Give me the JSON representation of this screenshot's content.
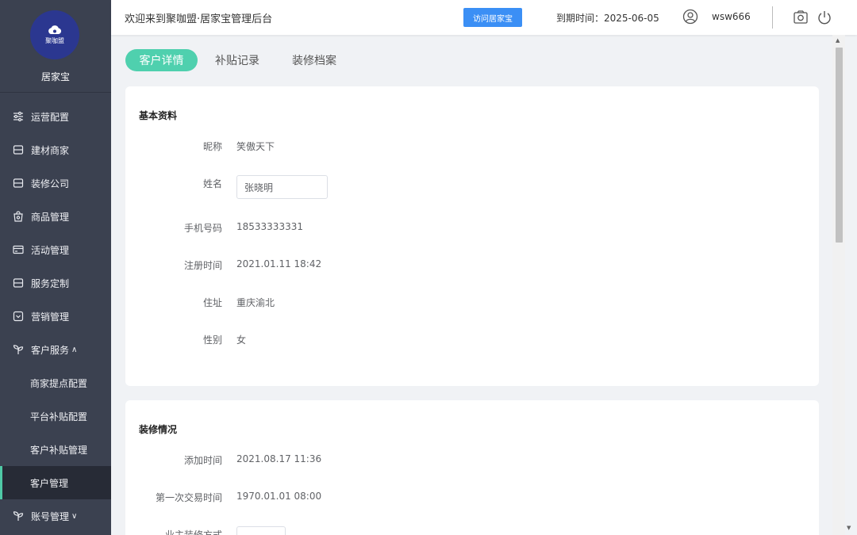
{
  "sidebar": {
    "logo_text": "聚咖盟",
    "brand": "居家宝",
    "items": [
      {
        "label": "运营配置",
        "icon": "sliders-icon"
      },
      {
        "label": "建材商家",
        "icon": "store-icon"
      },
      {
        "label": "装修公司",
        "icon": "store-icon"
      },
      {
        "label": "商品管理",
        "icon": "bag-icon"
      },
      {
        "label": "活动管理",
        "icon": "card-icon"
      },
      {
        "label": "服务定制",
        "icon": "store-icon"
      },
      {
        "label": "营销管理",
        "icon": "check-box-icon"
      },
      {
        "label": "客户服务",
        "icon": "sprout-icon",
        "chevron": "∧"
      }
    ],
    "sub_items": [
      "商家提点配置",
      "平台补贴配置",
      "客户补贴管理",
      "客户管理"
    ],
    "account": {
      "label": "账号管理",
      "chevron": "∨"
    }
  },
  "header": {
    "title": "欢迎来到聚咖盟·居家宝管理后台",
    "visit_button": "访问居家宝",
    "expire": "到期时间：2025-06-05",
    "username": "wsw666"
  },
  "tabs": [
    "客户详情",
    "补贴记录",
    "装修档案"
  ],
  "basic": {
    "title": "基本资料",
    "nickname_label": "昵称",
    "nickname": "笑傲天下",
    "name_label": "姓名",
    "name": "张晓明",
    "phone_label": "手机号码",
    "phone": "18533333331",
    "reg_label": "注册时间",
    "reg": "2021.01.11 18:42",
    "addr_label": "住址",
    "addr": "重庆渝北",
    "gender_label": "性别",
    "gender": "女"
  },
  "renovation": {
    "title": "装修情况",
    "added_label": "添加时间",
    "added": "2021.08.17 11:36",
    "first_label": "第一次交易时间",
    "first": "1970.01.01 08:00",
    "method_label": "业主装修方式"
  }
}
